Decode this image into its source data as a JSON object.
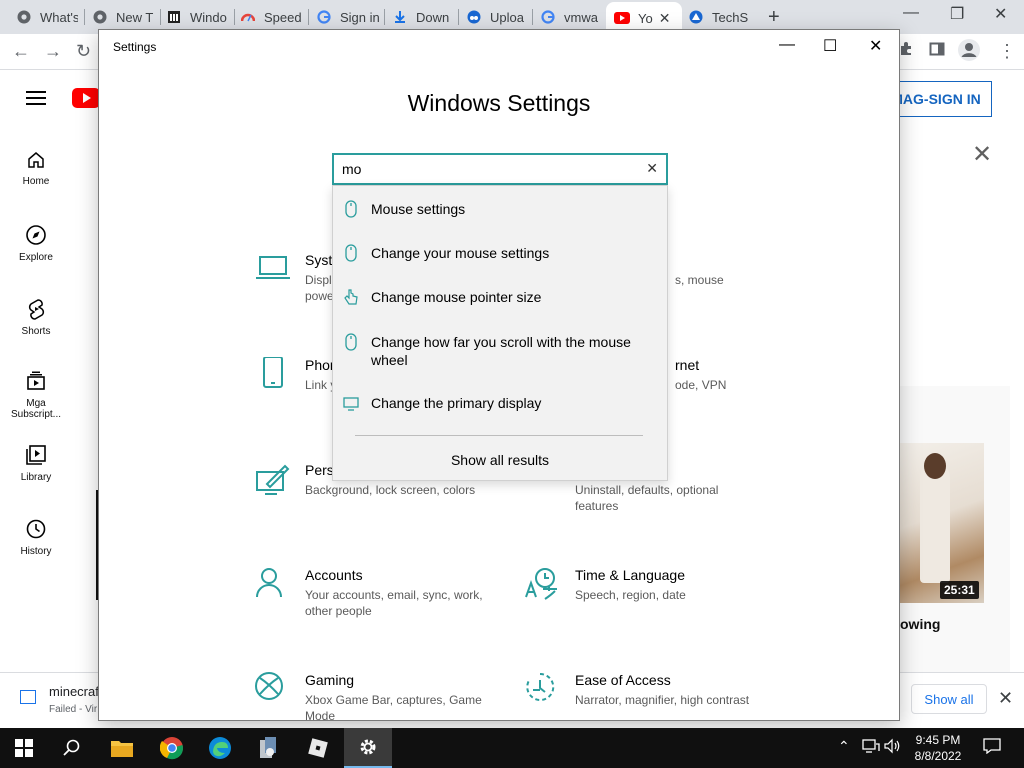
{
  "browser": {
    "tabs": [
      {
        "label": "What's"
      },
      {
        "label": "New T"
      },
      {
        "label": "Windo"
      },
      {
        "label": "Speed"
      },
      {
        "label": "Sign in"
      },
      {
        "label": "Down"
      },
      {
        "label": "Uploa"
      },
      {
        "label": "vmwa"
      },
      {
        "label": "Yo"
      },
      {
        "label": "TechS"
      }
    ],
    "new_tab": "+"
  },
  "youtube": {
    "nav": [
      {
        "label": "Home"
      },
      {
        "label": "Explore"
      },
      {
        "label": "Shorts"
      },
      {
        "label": "Mga Subscript..."
      },
      {
        "label": "Library"
      },
      {
        "label": "History"
      }
    ],
    "signin": "MAG-SIGN IN",
    "video_duration": "25:31",
    "video_title_fragment": "owing"
  },
  "download_bar": {
    "file_name": "minecraf",
    "status": "Failed - Vir",
    "show_all": "Show all"
  },
  "settings": {
    "window_title": "Settings",
    "heading": "Windows Settings",
    "search": {
      "value": "mo"
    },
    "suggestions": [
      {
        "label": "Mouse settings",
        "icon": "mouse-icon"
      },
      {
        "label": "Change your mouse settings",
        "icon": "mouse-icon"
      },
      {
        "label": "Change mouse pointer size",
        "icon": "pointer-hand-icon"
      },
      {
        "label": "Change how far you scroll with the mouse wheel",
        "icon": "mouse-icon"
      },
      {
        "label": "Change the primary display",
        "icon": "monitor-icon"
      }
    ],
    "show_all_results": "Show all results",
    "categories": {
      "system": {
        "title": "Syste",
        "desc": "Displ\npowe"
      },
      "devices": {
        "desc_fragment": "s, mouse"
      },
      "phone": {
        "title": "Phon",
        "desc": "Link y"
      },
      "network": {
        "title": "rnet",
        "desc": "ode, VPN"
      },
      "personalization": {
        "title": "Perso",
        "desc": "Background, lock screen, colors"
      },
      "apps": {
        "desc": "Uninstall, defaults, optional features"
      },
      "accounts": {
        "title": "Accounts",
        "desc": "Your accounts, email, sync, work, other people"
      },
      "time_language": {
        "title": "Time & Language",
        "desc": "Speech, region, date"
      },
      "gaming": {
        "title": "Gaming",
        "desc": "Xbox Game Bar, captures, Game Mode"
      },
      "ease_of_access": {
        "title": "Ease of Access",
        "desc": "Narrator, magnifier, high contrast"
      }
    }
  },
  "taskbar": {
    "time": "9:45 PM",
    "date": "8/8/2022"
  },
  "colors": {
    "accent_teal": "#2a9d9d",
    "taskbar_bg": "#101010",
    "youtube_red": "#ff0000",
    "link_blue": "#1565c0"
  }
}
